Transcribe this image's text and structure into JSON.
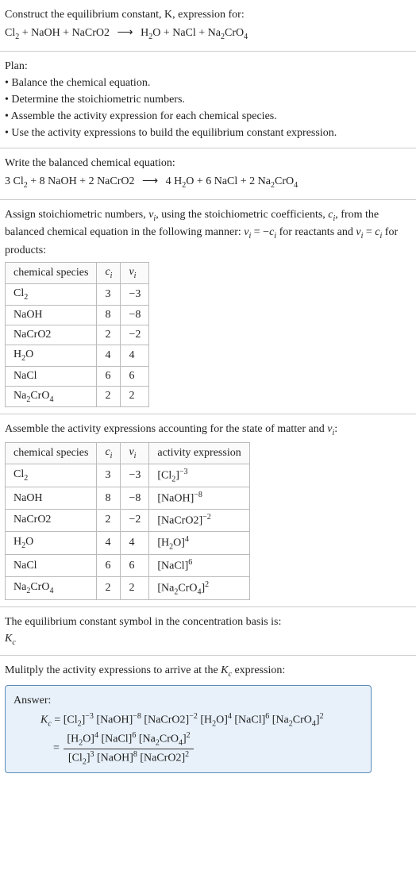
{
  "intro": {
    "prompt": "Construct the equilibrium constant, K, expression for:",
    "unbalanced_lhs_1": "Cl",
    "unbalanced_lhs_1s": "2",
    "plus1": " + NaOH + NaCrO2 ",
    "arrow": "⟶",
    "rhs_h2o": " H",
    "rhs_h2o_s": "2",
    "rhs_h2o_o": "O + NaCl + Na",
    "rhs_na2": "2",
    "rhs_cro": "CrO",
    "rhs_cro_s": "4"
  },
  "plan": {
    "heading": "Plan:",
    "b1": "• Balance the chemical equation.",
    "b2": "• Determine the stoichiometric numbers.",
    "b3": "• Assemble the activity expression for each chemical species.",
    "b4": "• Use the activity expressions to build the equilibrium constant expression."
  },
  "balanced": {
    "heading": "Write the balanced chemical equation:",
    "c1": "3 Cl",
    "c1s": "2",
    "c2": " + 8 NaOH + 2 NaCrO2 ",
    "arrow": "⟶",
    "r1": " 4 H",
    "r1s": "2",
    "r1o": "O + 6 NaCl + 2 Na",
    "r2s": "2",
    "r2": "CrO",
    "r3s": "4"
  },
  "assign": {
    "text_a": "Assign stoichiometric numbers, ",
    "nu": "ν",
    "nu_i": "i",
    "text_b": ", using the stoichiometric coefficients, ",
    "c": "c",
    "c_i": "i",
    "text_c": ", from the balanced chemical equation in the following manner: ",
    "eq1_l": "ν",
    "eq1_li": "i",
    "eq1_m": " = −",
    "eq1_r": "c",
    "eq1_ri": "i",
    "text_d": " for reactants and ",
    "eq2_l": "ν",
    "eq2_li": "i",
    "eq2_m": " = ",
    "eq2_r": "c",
    "eq2_ri": "i",
    "text_e": " for products:"
  },
  "table1": {
    "h1": "chemical species",
    "h2": "c",
    "h2i": "i",
    "h3": "ν",
    "h3i": "i",
    "rows": [
      {
        "sp_a": "Cl",
        "sp_s": "2",
        "c": "3",
        "v": "−3"
      },
      {
        "sp_a": "NaOH",
        "sp_s": "",
        "c": "8",
        "v": "−8"
      },
      {
        "sp_a": "NaCrO2",
        "sp_s": "",
        "c": "2",
        "v": "−2"
      },
      {
        "sp_a": "H",
        "sp_s": "2",
        "sp_b": "O",
        "c": "4",
        "v": "4"
      },
      {
        "sp_a": "NaCl",
        "sp_s": "",
        "c": "6",
        "v": "6"
      },
      {
        "sp_a": "Na",
        "sp_s": "2",
        "sp_b": "CrO",
        "sp_s2": "4",
        "c": "2",
        "v": "2"
      }
    ]
  },
  "assemble": {
    "text_a": "Assemble the activity expressions accounting for the state of matter and ",
    "nu": "ν",
    "nu_i": "i",
    "text_b": ":"
  },
  "table2": {
    "h1": "chemical species",
    "h2": "c",
    "h2i": "i",
    "h3": "ν",
    "h3i": "i",
    "h4": "activity expression",
    "rows": [
      {
        "sp_a": "Cl",
        "sp_s": "2",
        "c": "3",
        "v": "−3",
        "ae_a": "[Cl",
        "ae_s": "2",
        "ae_b": "]",
        "ae_e": "−3"
      },
      {
        "sp_a": "NaOH",
        "c": "8",
        "v": "−8",
        "ae_a": "[NaOH]",
        "ae_e": "−8"
      },
      {
        "sp_a": "NaCrO2",
        "c": "2",
        "v": "−2",
        "ae_a": "[NaCrO2]",
        "ae_e": "−2"
      },
      {
        "sp_a": "H",
        "sp_s": "2",
        "sp_b": "O",
        "c": "4",
        "v": "4",
        "ae_a": "[H",
        "ae_s": "2",
        "ae_b": "O]",
        "ae_e": "4"
      },
      {
        "sp_a": "NaCl",
        "c": "6",
        "v": "6",
        "ae_a": "[NaCl]",
        "ae_e": "6"
      },
      {
        "sp_a": "Na",
        "sp_s": "2",
        "sp_b": "CrO",
        "sp_s2": "4",
        "c": "2",
        "v": "2",
        "ae_a": "[Na",
        "ae_s": "2",
        "ae_b": "CrO",
        "ae_s2": "4",
        "ae_c": "]",
        "ae_e": "2"
      }
    ]
  },
  "symbol": {
    "text": "The equilibrium constant symbol in the concentration basis is:",
    "K": "K",
    "Kc": "c"
  },
  "multiply": {
    "text_a": "Mulitply the activity expressions to arrive at the ",
    "K": "K",
    "Kc": "c",
    "text_b": " expression:"
  },
  "answer": {
    "label": "Answer:",
    "K": "K",
    "Kc": "c",
    "eq": " = ",
    "t1": "[Cl",
    "t1s": "2",
    "t1b": "]",
    "t1e": "−3",
    "t2": " [NaOH]",
    "t2e": "−8",
    "t3": " [NaCrO2]",
    "t3e": "−2",
    "t4": " [H",
    "t4s": "2",
    "t4b": "O]",
    "t4e": "4",
    "t5": " [NaCl]",
    "t5e": "6",
    "t6": " [Na",
    "t6s": "2",
    "t6b": "CrO",
    "t6s2": "4",
    "t6c": "]",
    "t6e": "2",
    "eq2": "= ",
    "num1": "[H",
    "num1s": "2",
    "num1b": "O]",
    "num1e": "4",
    "num2": " [NaCl]",
    "num2e": "6",
    "num3": " [Na",
    "num3s": "2",
    "num3b": "CrO",
    "num3s2": "4",
    "num3c": "]",
    "num3e": "2",
    "den1": "[Cl",
    "den1s": "2",
    "den1b": "]",
    "den1e": "3",
    "den2": " [NaOH]",
    "den2e": "8",
    "den3": " [NaCrO2]",
    "den3e": "2"
  }
}
